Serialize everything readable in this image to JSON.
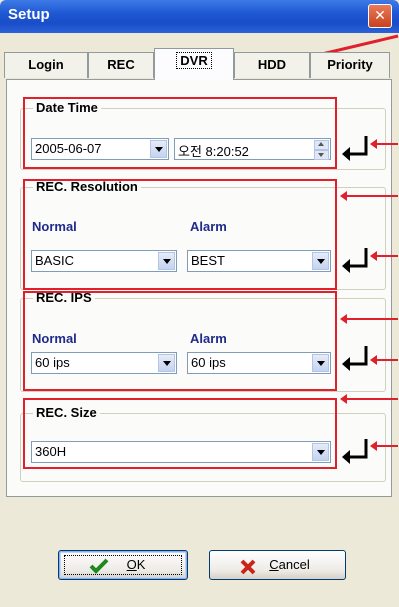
{
  "window": {
    "title": "Setup",
    "close_glyph": "✕"
  },
  "tabs": [
    "Login",
    "REC",
    "DVR",
    "HDD",
    "Priority"
  ],
  "active_tab": "DVR",
  "date_time": {
    "label": "Date Time",
    "date": "2005-06-07",
    "time": "오전   8:20:52"
  },
  "rec_resolution": {
    "label": "REC. Resolution",
    "normal_label": "Normal",
    "alarm_label": "Alarm",
    "normal_value": "BASIC",
    "alarm_value": "BEST"
  },
  "rec_ips": {
    "label": "REC. IPS",
    "normal_label": "Normal",
    "alarm_label": "Alarm",
    "normal_value": "60 ips",
    "alarm_value": "60 ips"
  },
  "rec_size": {
    "label": "REC. Size",
    "value": "360H"
  },
  "buttons": {
    "ok_label": "OK",
    "ok_mnemonic": "O",
    "ok_rest": "K",
    "cancel_label": "Cancel",
    "cancel_mnemonic": "C",
    "cancel_rest": "ancel"
  },
  "icons": {
    "enter": "enter-arrow-icon",
    "check": "check-icon",
    "x": "x-icon"
  },
  "colors": {
    "annotation": "#e0202a",
    "title_bar": "#1f58d3",
    "sub_label": "#1f2a8a"
  }
}
